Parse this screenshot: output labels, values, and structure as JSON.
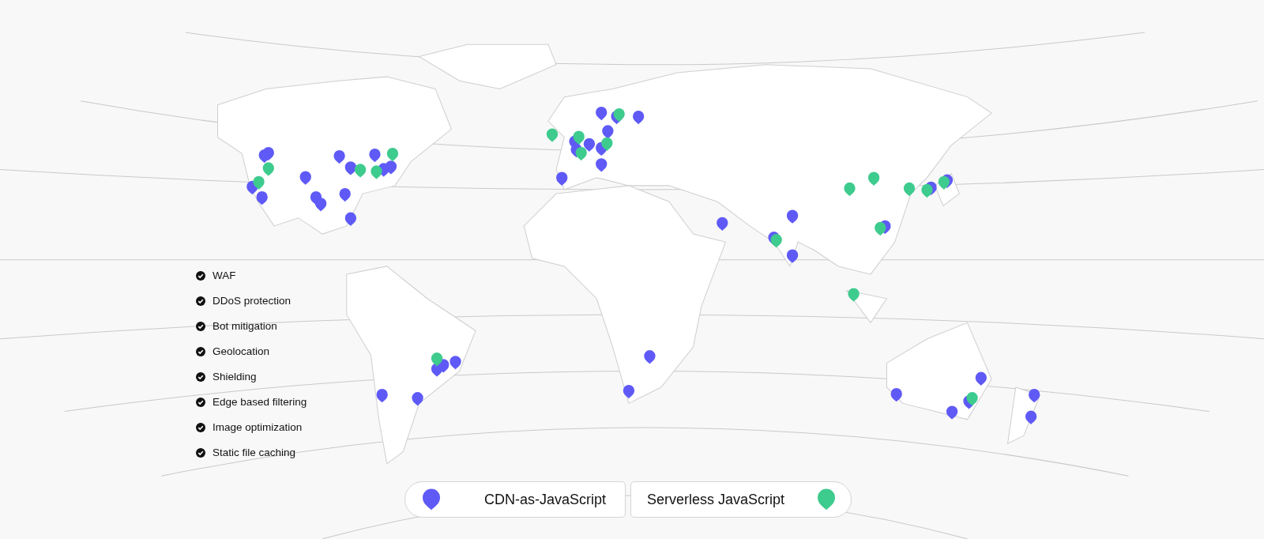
{
  "features": [
    {
      "label": "WAF"
    },
    {
      "label": "DDoS protection"
    },
    {
      "label": "Bot mitigation"
    },
    {
      "label": "Geolocation"
    },
    {
      "label": "Shielding"
    },
    {
      "label": "Edge based filtering"
    },
    {
      "label": "Image optimization"
    },
    {
      "label": "Static file caching"
    }
  ],
  "legend": [
    {
      "label": "CDN-as-JavaScript",
      "color": "#5f5af6"
    },
    {
      "label": "Serverless JavaScript",
      "color": "#3ecb8e"
    }
  ]
}
